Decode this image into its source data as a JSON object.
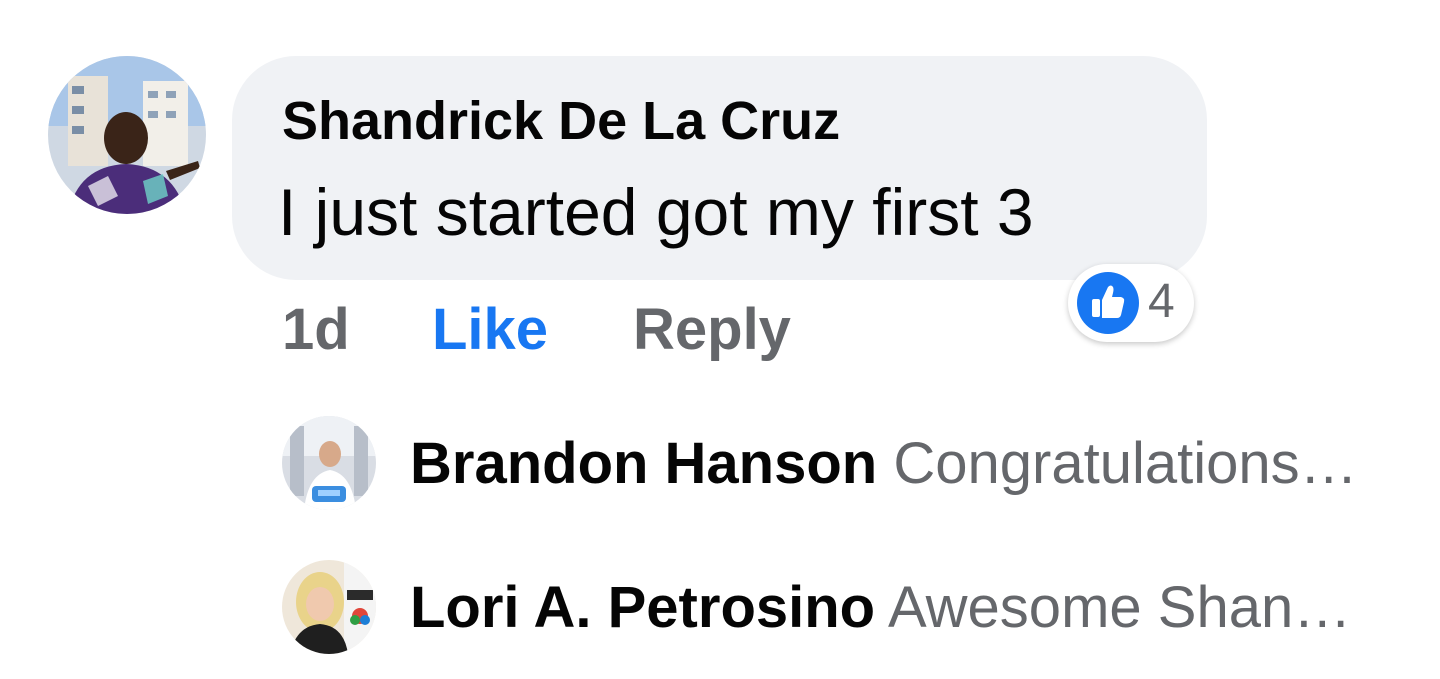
{
  "comment": {
    "author": "Shandrick De La Cruz",
    "text": "I just started got my first 3",
    "time": "1d",
    "like_label": "Like",
    "reply_label": "Reply",
    "reactions": {
      "icon": "thumbs-up-icon",
      "count": "4",
      "color": "#1877f2"
    }
  },
  "replies": [
    {
      "author": "Brandon Hanson",
      "snippet": "Congratulations…"
    },
    {
      "author": "Lori A. Petrosino",
      "snippet": "Awesome Shan…"
    }
  ],
  "colors": {
    "bubble": "#f0f2f5",
    "link_blue": "#1877f2",
    "secondary_text": "#65676b",
    "primary_text": "#050505"
  }
}
